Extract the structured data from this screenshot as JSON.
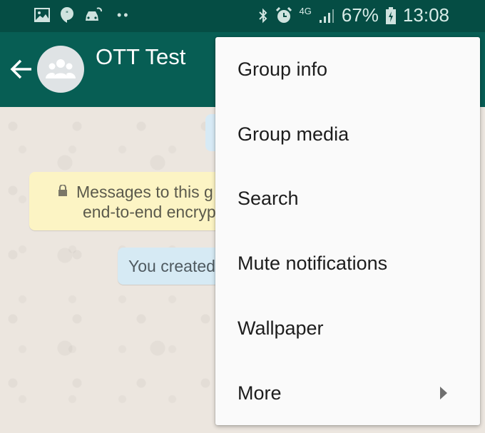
{
  "status_bar": {
    "left_icons": [
      "gallery-icon",
      "hangouts-icon",
      "car-mode-icon",
      "more-notifications-icon"
    ],
    "right_icons": [
      "bluetooth-icon",
      "alarm-icon",
      "4g-data-icon",
      "signal-icon",
      "battery-charging-icon"
    ],
    "network": "4G",
    "battery": "67%",
    "time": "13:08"
  },
  "app_bar": {
    "title": "OTT Test",
    "back_icon": "arrow-left-icon",
    "avatar_icon": "group-icon"
  },
  "chat": {
    "encryption_notice": {
      "line1": "Messages to this g",
      "line2": "end-to-end encryp"
    },
    "system_message": "You created"
  },
  "menu": {
    "items": [
      {
        "label": "Group info"
      },
      {
        "label": "Group media"
      },
      {
        "label": "Search"
      },
      {
        "label": "Mute notifications"
      },
      {
        "label": "Wallpaper"
      },
      {
        "label": "More",
        "has_submenu": true
      }
    ]
  },
  "colors": {
    "status_bar": "#054d44",
    "app_bar": "#075e54",
    "menu_bg": "#fafafa",
    "encryption_bg": "#fcf4c4",
    "system_bubble_bg": "#d6eaf4"
  }
}
